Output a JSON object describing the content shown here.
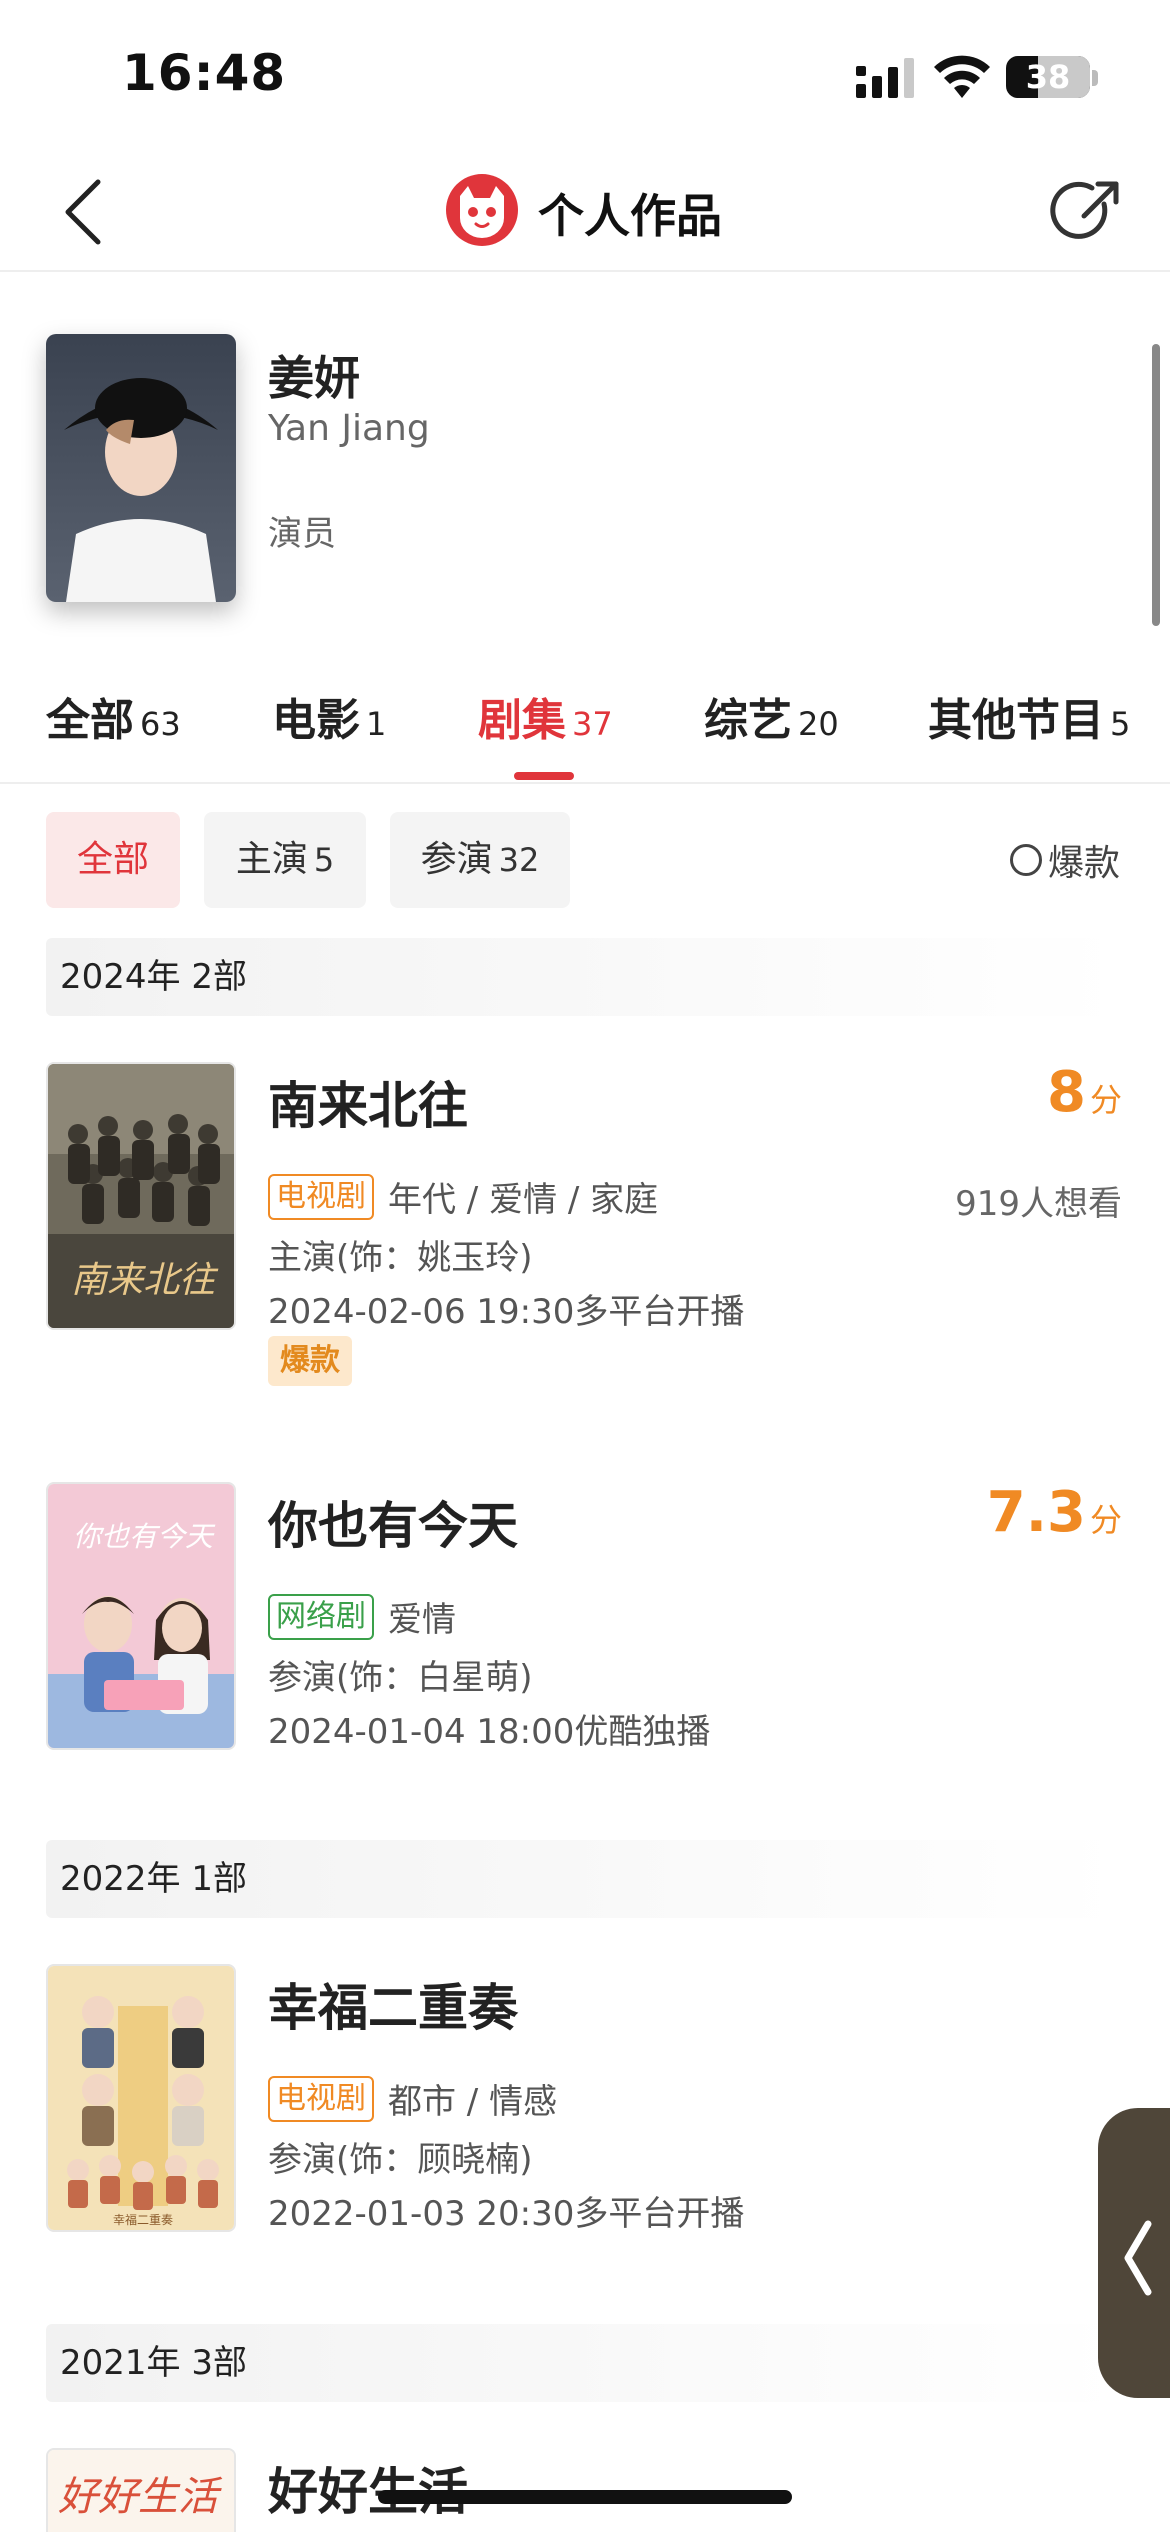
{
  "status": {
    "time": "16:48",
    "battery": "38",
    "battery_level": 0.38
  },
  "nav": {
    "title": "个人作品"
  },
  "profile": {
    "name_cn": "姜妍",
    "name_en": "Yan Jiang",
    "role": "演员"
  },
  "tabs": [
    {
      "label": "全部",
      "count": "63"
    },
    {
      "label": "电影",
      "count": "1"
    },
    {
      "label": "剧集",
      "count": "37"
    },
    {
      "label": "综艺",
      "count": "20"
    },
    {
      "label": "其他节目",
      "count": "5"
    }
  ],
  "active_tab": "剧集",
  "filters": [
    {
      "label": "全部",
      "count": ""
    },
    {
      "label": "主演",
      "count": "5"
    },
    {
      "label": "参演",
      "count": "32"
    }
  ],
  "hit_toggle": {
    "label": "爆款"
  },
  "years": [
    {
      "label": "2024年  2部"
    },
    {
      "label": "2022年  1部"
    },
    {
      "label": "2021年  3部"
    }
  ],
  "works": [
    {
      "title": "南来北往",
      "score": "8",
      "score_unit": "分",
      "type": "电视剧",
      "genres": "年代 / 爱情 / 家庭",
      "want": "919人想看",
      "role": "主演(饰：姚玉玲)",
      "release": "2024-02-06 19:30多平台开播",
      "badge": "爆款",
      "poster_text": "南来北往"
    },
    {
      "title": "你也有今天",
      "score": "7.3",
      "score_unit": "分",
      "type": "网络剧",
      "genres": "爱情",
      "role": "参演(饰：白星萌)",
      "release": "2024-01-04 18:00优酷独播",
      "poster_text": "你也有今天"
    },
    {
      "title": "幸福二重奏",
      "type": "电视剧",
      "genres": "都市 / 情感",
      "role": "参演(饰：顾晓楠)",
      "release": "2022-01-03 20:30多平台开播",
      "poster_text": "幸福二重奏"
    },
    {
      "title": "好好生活",
      "poster_text": "好好生活"
    }
  ],
  "colors": {
    "accent": "#e0353b",
    "score": "#f08a24",
    "tv_badge": "#f08a24",
    "web_badge": "#3aa04a"
  }
}
